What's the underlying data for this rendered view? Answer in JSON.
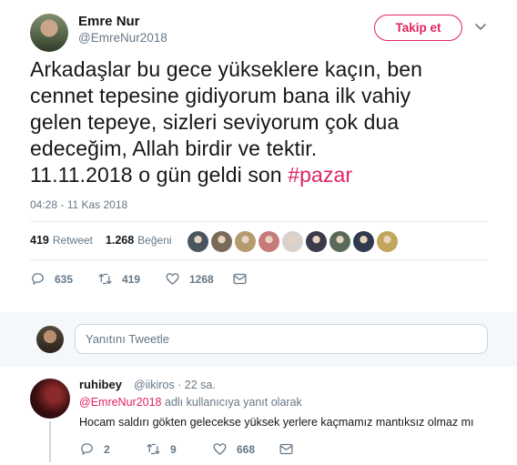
{
  "tweet": {
    "author_name": "Emre Nur",
    "author_handle": "@EmreNur2018",
    "follow_label": "Takip et",
    "text_lines": [
      "Arkadaşlar bu gece yükseklere kaçın, ben",
      "cennet tepesine gidiyorum bana ilk vahiy",
      "gelen tepeye, sizleri seviyorum çok dua",
      "edeceğim, Allah birdir ve tektir."
    ],
    "text_last_line_prefix": "11.11.2018 o gün geldi son ",
    "hashtag": "#pazar",
    "timestamp": "04:28 - 11 Kas 2018",
    "retweets_count": "419",
    "retweets_label": "Retweet",
    "likes_count": "1.268",
    "likes_label": "Beğeni",
    "liker_colors": [
      "#4a5560",
      "#7a6a5a",
      "#b59a6d",
      "#c77a7a",
      "#d9d2cc",
      "#3a3a4a",
      "#5a6a5a",
      "#2e3a4e",
      "#c2a55a"
    ],
    "actions": {
      "replies": "635",
      "retweets": "419",
      "likes": "1268"
    }
  },
  "reply_box": {
    "placeholder": "Yanıtını Tweetle"
  },
  "reply": {
    "author_name": "ruhibey",
    "author_handle_time": "@iikiros · 22 sa.",
    "replying_mention": "@EmreNur2018",
    "replying_suffix": " adlı kullanıcıya yanıt olarak",
    "text": "Hocam saldırı gökten gelecekse yüksek yerlere kaçmamız mantıksız olmaz mı",
    "actions": {
      "replies": "2",
      "retweets": "9",
      "likes": "668"
    }
  },
  "colors": {
    "accent": "#e0245e",
    "secondary_text": "#657786",
    "divider": "#e6ecf0"
  }
}
